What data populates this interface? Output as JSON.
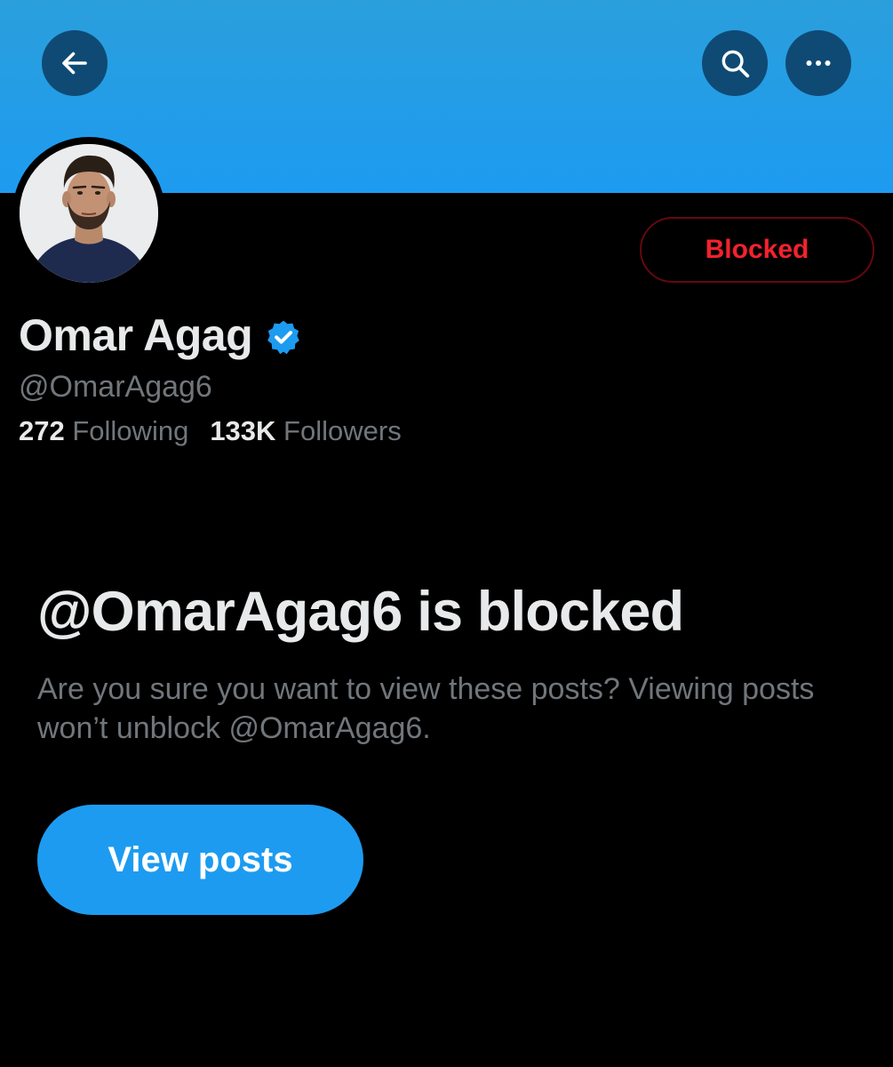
{
  "header": {
    "back_icon": "arrow-left-icon",
    "search_icon": "search-icon",
    "more_icon": "more-horizontal-icon",
    "banner_color": "#1d9bf0"
  },
  "profile": {
    "display_name": "Omar Agag",
    "verified": true,
    "verified_color": "#1d9bf0",
    "handle": "@OmarAgag6",
    "following_count": "272",
    "following_label": "Following",
    "followers_count": "133K",
    "followers_label": "Followers",
    "blocked_button_label": "Blocked",
    "blocked_color": "#f4212e"
  },
  "blocked_notice": {
    "title": "@OmarAgag6 is blocked",
    "description": "Are you sure you want to view these posts? Viewing posts won’t unblock @OmarAgag6.",
    "view_posts_label": "View posts",
    "accent": "#1d9bf0"
  }
}
